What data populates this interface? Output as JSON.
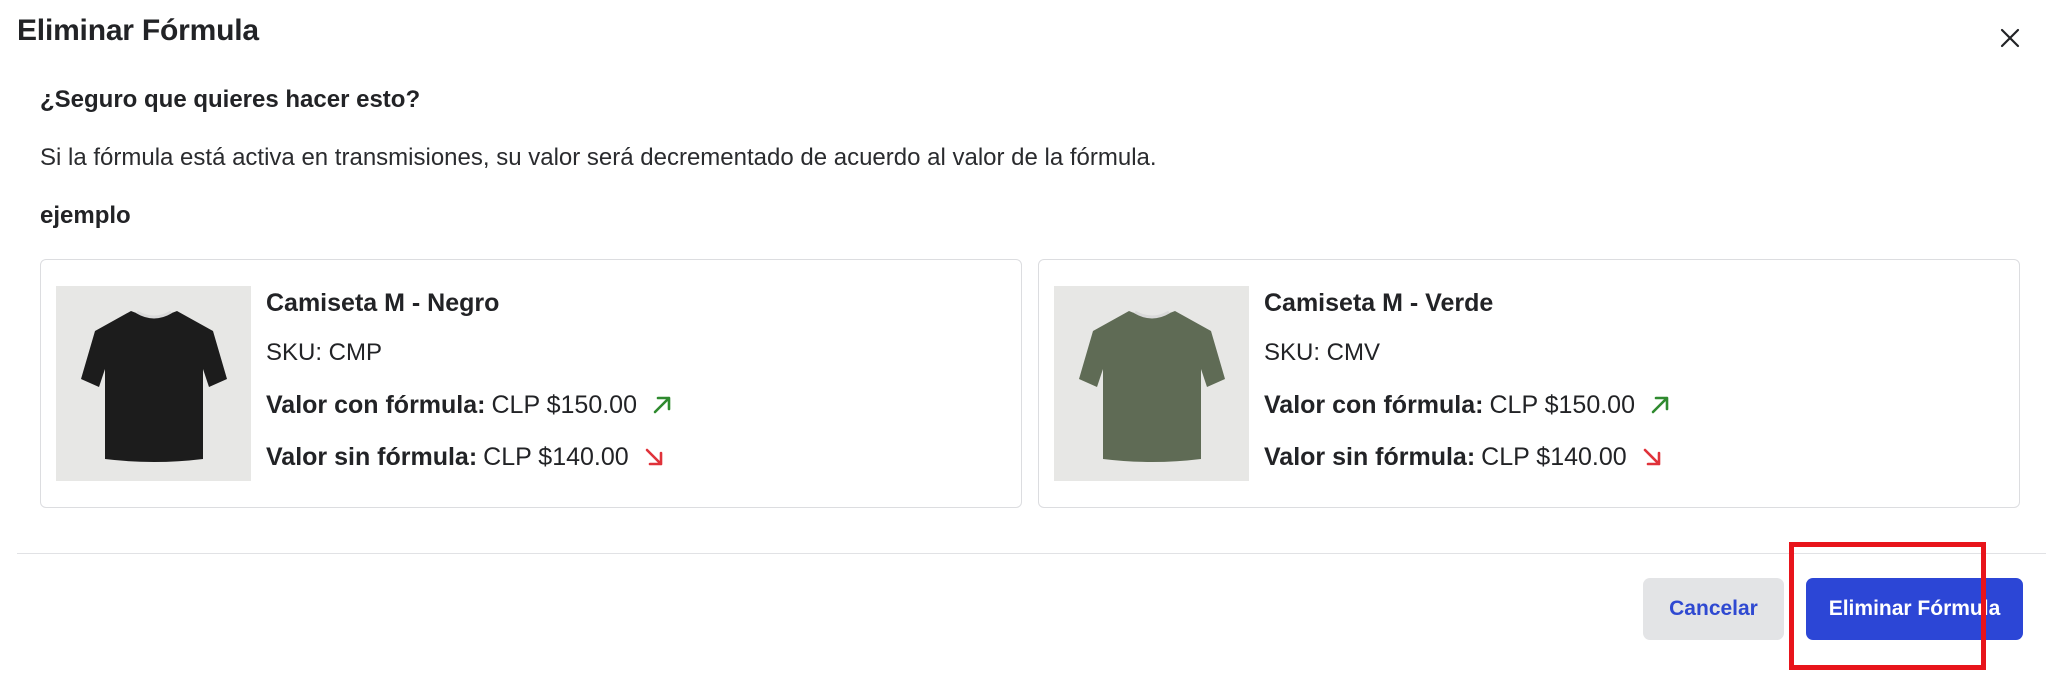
{
  "dialog": {
    "title": "Eliminar Fórmula",
    "close_icon": "close-icon"
  },
  "body": {
    "question": "¿Seguro que quieres hacer esto?",
    "description": "Si la fórmula está activa en transmisiones, su valor será decrementado de acuerdo al valor de la fórmula.",
    "example_label": "ejemplo"
  },
  "products": [
    {
      "name": "Camiseta M - Negro",
      "sku": "SKU: CMP",
      "with_formula_label": "Valor con fórmula:",
      "with_formula_value": "CLP $150.00",
      "without_formula_label": "Valor sin fórmula:",
      "without_formula_value": "CLP $140.00",
      "shirt_color": "#1c1c1c",
      "up_arrow_icon": "arrow-up-right-icon",
      "down_arrow_icon": "arrow-down-right-icon"
    },
    {
      "name": "Camiseta M - Verde",
      "sku": "SKU: CMV",
      "with_formula_label": "Valor con fórmula:",
      "with_formula_value": "CLP $150.00",
      "without_formula_label": "Valor sin fórmula:",
      "without_formula_value": "CLP $140.00",
      "shirt_color": "#5f6b55",
      "up_arrow_icon": "arrow-up-right-icon",
      "down_arrow_icon": "arrow-down-right-icon"
    }
  ],
  "footer": {
    "cancel_label": "Cancelar",
    "confirm_label": "Eliminar Fórmula"
  },
  "colors": {
    "primary": "#2c46d6",
    "up_arrow": "#2f8a2f",
    "down_arrow": "#e0323a",
    "highlight": "#e8141b"
  }
}
